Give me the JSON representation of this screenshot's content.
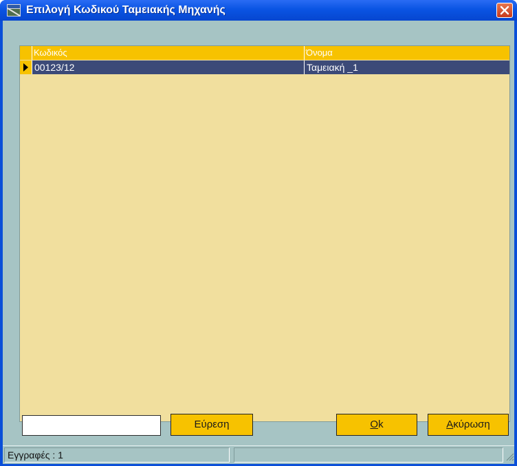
{
  "window": {
    "title": "Επιλογή Κωδικού Ταμειακής Μηχανής",
    "title_icon": "window-app-icon",
    "close_icon": "close-icon"
  },
  "grid": {
    "columns": [
      "Κωδικός",
      "Όνομα"
    ],
    "rows": [
      {
        "code": "00123/12",
        "name": "Ταμειακή _1",
        "selected": true
      }
    ]
  },
  "search": {
    "value": "",
    "placeholder": ""
  },
  "buttons": {
    "find": "Εύρεση",
    "ok_hotkey": "O",
    "ok_rest": "k",
    "cancel_hotkey": "Α",
    "cancel_rest": "κύρωση"
  },
  "status": {
    "records": "Εγγραφές : 1",
    "secondary": ""
  },
  "colors": {
    "accent": "#f7c200",
    "grid_bg": "#f1df9e",
    "selected_row": "#3c4a78",
    "panel": "#a6c4c4"
  }
}
